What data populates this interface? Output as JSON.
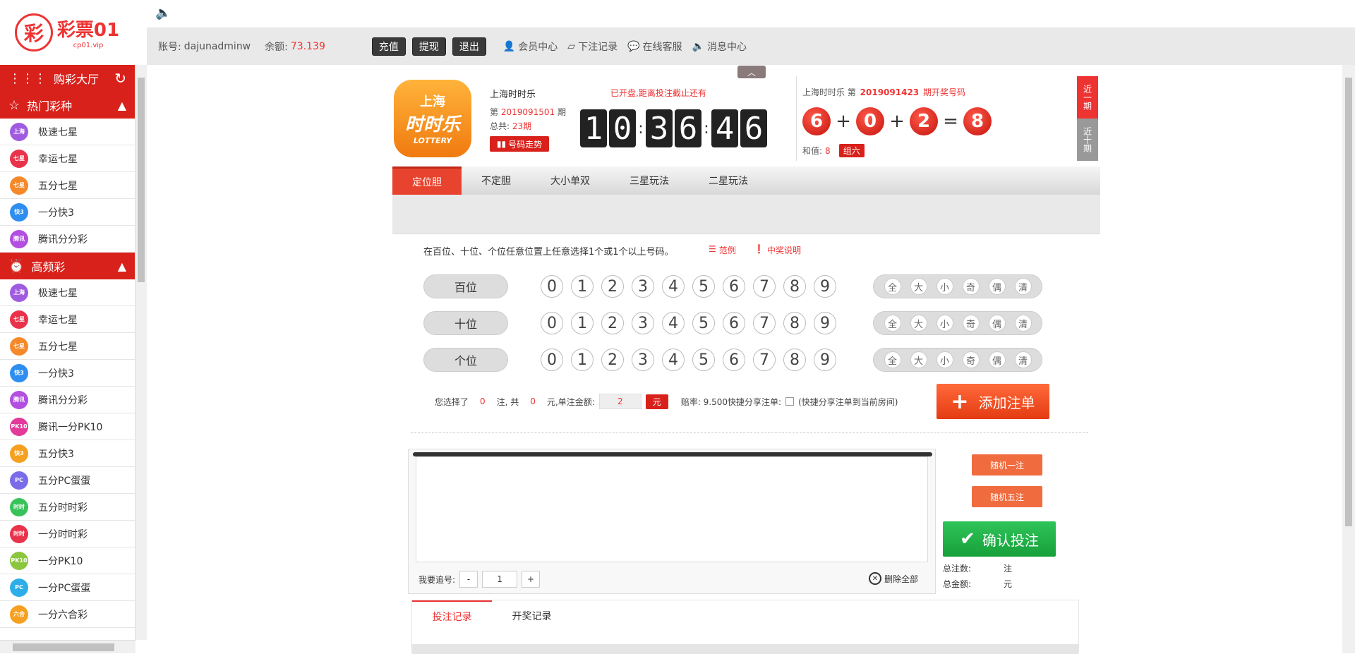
{
  "logo": {
    "brand": "彩票01",
    "sub": "cp01.vip",
    "mark": "彩"
  },
  "sidebar": {
    "hall": "购彩大厅",
    "hot_title": "热门彩种",
    "hot_items": [
      {
        "label": "极速七星",
        "color": "#a05ce0",
        "txt": "上海"
      },
      {
        "label": "幸运七星",
        "color": "#e8334b",
        "txt": "七星"
      },
      {
        "label": "五分七星",
        "color": "#f5892a",
        "txt": "七星"
      },
      {
        "label": "一分快3",
        "color": "#2e8ef0",
        "txt": "快3"
      },
      {
        "label": "腾讯分分彩",
        "color": "#b24ee0",
        "txt": "腾讯"
      }
    ],
    "freq_title": "高频彩",
    "freq_items": [
      {
        "label": "极速七星",
        "color": "#a05ce0",
        "txt": "上海"
      },
      {
        "label": "幸运七星",
        "color": "#e8334b",
        "txt": "七星"
      },
      {
        "label": "五分七星",
        "color": "#f5892a",
        "txt": "七星"
      },
      {
        "label": "一分快3",
        "color": "#2e8ef0",
        "txt": "快3"
      },
      {
        "label": "腾讯分分彩",
        "color": "#b24ee0",
        "txt": "腾讯"
      },
      {
        "label": "腾讯一分PK10",
        "color": "#e3399a",
        "txt": "PK10"
      },
      {
        "label": "五分快3",
        "color": "#f5a020",
        "txt": "快3"
      },
      {
        "label": "五分PC蛋蛋",
        "color": "#7a6ce8",
        "txt": "PC"
      },
      {
        "label": "五分时时彩",
        "color": "#39c25a",
        "txt": "时时"
      },
      {
        "label": "一分时时彩",
        "color": "#e8334b",
        "txt": "时时"
      },
      {
        "label": "一分PK10",
        "color": "#8cc63f",
        "txt": "PK10"
      },
      {
        "label": "一分PC蛋蛋",
        "color": "#2eaee8",
        "txt": "PC"
      },
      {
        "label": "一分六合彩",
        "color": "#f5a020",
        "txt": "六合"
      }
    ]
  },
  "userbar": {
    "account_label": "账号:",
    "account": "dajunadminw",
    "balance_label": "余额:",
    "balance": "73.139",
    "recharge": "充值",
    "withdraw": "提现",
    "logout": "退出",
    "member": "会员中心",
    "bets": "下注记录",
    "service": "在线客服",
    "messages": "消息中心"
  },
  "lottery": {
    "logo_top": "上海",
    "logo_mid": "时时乐",
    "logo_bottom": "LOTTERY",
    "name": "上海时时乐",
    "issue_prefix": "第",
    "issue": "2019091501",
    "issue_suffix": "期",
    "total_label": "总共:",
    "total": "23期",
    "trend_btn": "号码走势",
    "status": "已开盘,距离投注截止还有",
    "timer": [
      "1",
      "0",
      "3",
      "6",
      "4",
      "6"
    ]
  },
  "result": {
    "title_prefix": "上海时时乐 第",
    "issue": "2019091423",
    "title_suffix": "期开奖号码",
    "balls": [
      "6",
      "0",
      "2"
    ],
    "sum": "8",
    "plus": "+",
    "eq": "=",
    "sum_label": "和值:",
    "sum_value": "8",
    "group": "组六",
    "recent1": "近一期",
    "recent10": "近十期"
  },
  "tabs": [
    "定位胆",
    "不定胆",
    "大小单双",
    "三星玩法",
    "二星玩法"
  ],
  "play": {
    "instruction": "在百位、十位、个位任意位置上任意选择1个或1个以上号码。",
    "example": "范例",
    "prize_info": "中奖说明",
    "positions": [
      "百位",
      "十位",
      "个位"
    ],
    "numbers": [
      "0",
      "1",
      "2",
      "3",
      "4",
      "5",
      "6",
      "7",
      "8",
      "9"
    ],
    "quick": [
      "全",
      "大",
      "小",
      "奇",
      "偶",
      "清"
    ]
  },
  "summary": {
    "selected_label": "您选择了",
    "selected": "0",
    "bets_label": "注, 共",
    "amount": "0",
    "unit_label": "元,单注金额:",
    "unit_value": "2",
    "yuan_btn": "元",
    "odds": "赔率: 9.500快捷分享注单:",
    "share": "(快捷分享注单到当前房间)",
    "add_btn": "添加注单"
  },
  "cart": {
    "chase_label": "我要追号:",
    "minus": "-",
    "chase_value": "1",
    "plus": "+",
    "delete_all": "删除全部",
    "random1": "随机一注",
    "random5": "随机五注",
    "confirm": "确认投注",
    "total_bets_label": "总注数:",
    "total_bets_unit": "注",
    "total_amount_label": "总金额:",
    "total_amount_unit": "元"
  },
  "records": {
    "tab1": "投注记录",
    "tab2": "开奖记录"
  }
}
